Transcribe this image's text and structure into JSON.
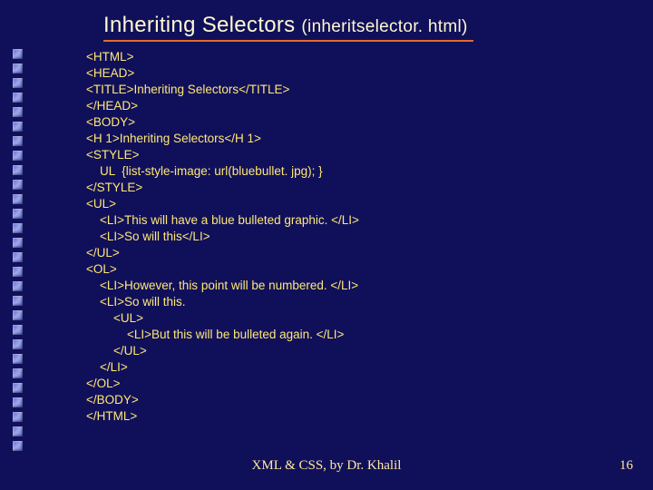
{
  "title": {
    "main": "Inheriting Selectors ",
    "sub": "(inheritselector. html)"
  },
  "code_lines": [
    "<HTML>",
    "<HEAD>",
    "<TITLE>Inheriting Selectors</TITLE>",
    "</HEAD>",
    "<BODY>",
    "<H 1>Inheriting Selectors</H 1>",
    "<STYLE>",
    "    UL  {list-style-image: url(bluebullet. jpg); }",
    "</STYLE>",
    "<UL>",
    "    <LI>This will have a blue bulleted graphic. </LI>",
    "    <LI>So will this</LI>",
    "</UL>",
    "<OL>",
    "    <LI>However, this point will be numbered. </LI>",
    "    <LI>So will this.",
    "        <UL>",
    "            <LI>But this will be bulleted again. </LI>",
    "        </UL>",
    "    </LI>",
    "</OL>",
    "</BODY>",
    "</HTML>"
  ],
  "footer": "XML & CSS, by Dr. Khalil",
  "page_number": "16",
  "bullet_count": 28
}
